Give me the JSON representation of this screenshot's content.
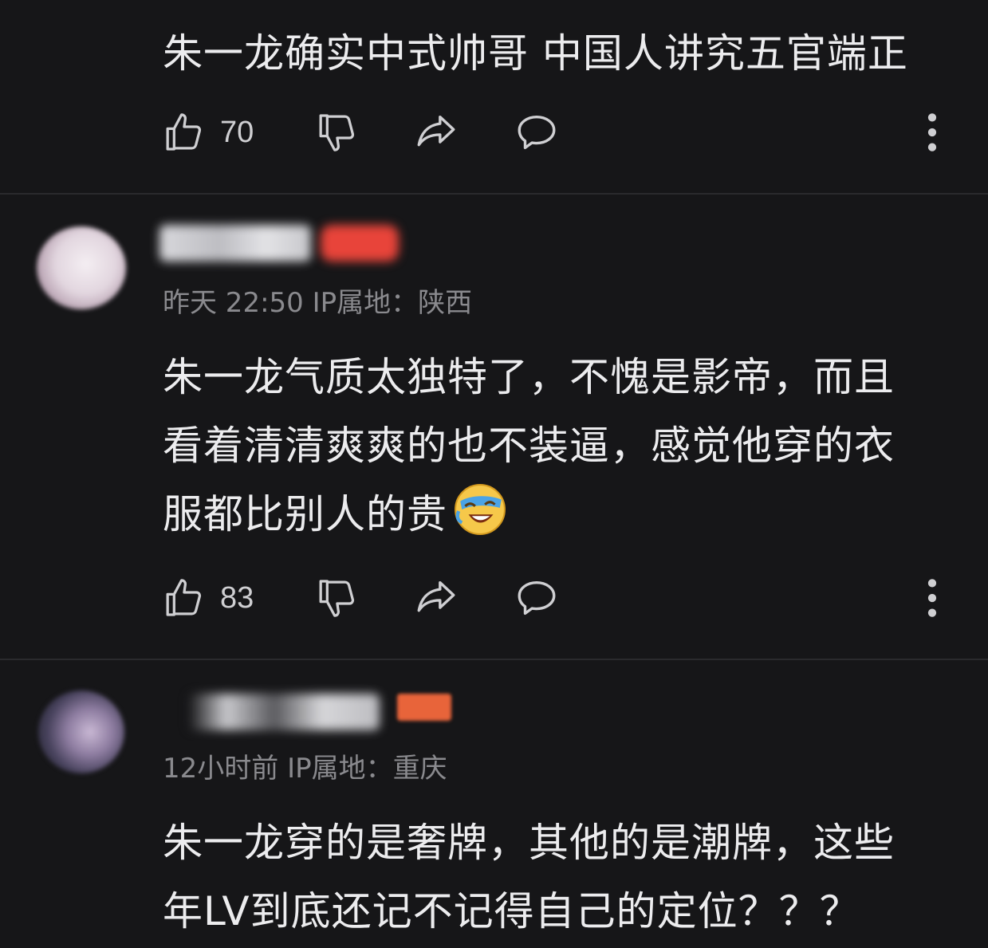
{
  "comments": [
    {
      "text": "朱一龙确实中式帅哥 中国人讲究五官端正",
      "likes": "70"
    },
    {
      "meta": "昨天 22:50 IP属地：陕西",
      "text_line1": "朱一龙气质太独特了，不愧是影帝，而且",
      "text_line2": "看着清清爽爽的也不装逼，感觉他穿的衣",
      "text_line3": "服都比别人的贵",
      "emoji": "laughing-crying-emoji",
      "likes": "83"
    },
    {
      "meta": "12小时前 IP属地：重庆",
      "text_line1": "朱一龙穿的是奢牌，其他的是潮牌，这些",
      "text_line2": "年LV到底还记不记得自己的定位？？？"
    }
  ],
  "icons": {
    "like": "thumbs-up-icon",
    "dislike": "thumbs-down-icon",
    "share": "share-icon",
    "reply": "comment-icon",
    "more": "more-vertical-icon"
  },
  "colors": {
    "background": "#161618",
    "text": "#ececee",
    "meta": "#8a8a8e",
    "icon": "#cfcfd2",
    "divider": "#2a2a2d",
    "badge": "#e8443a"
  }
}
